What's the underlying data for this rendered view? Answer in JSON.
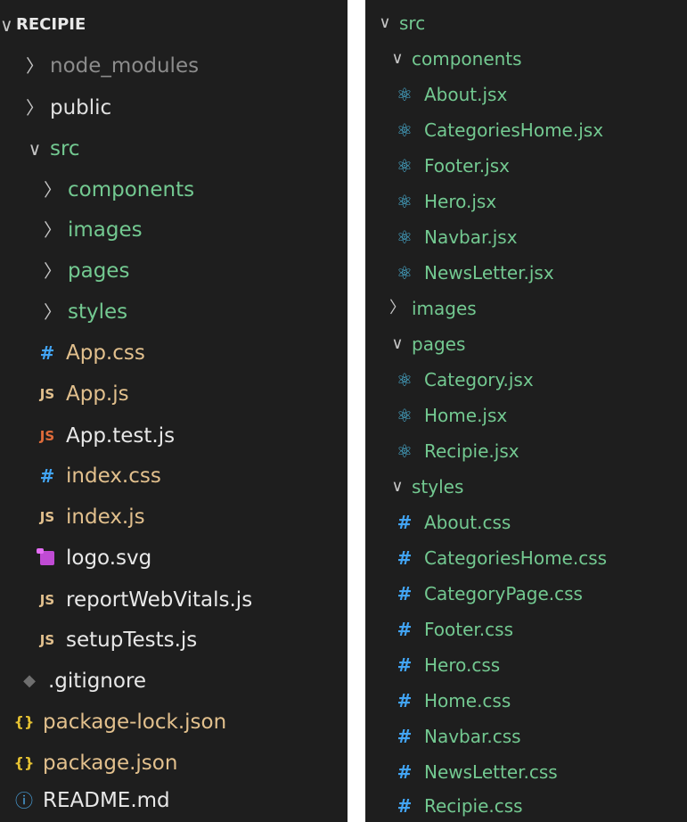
{
  "colors": {
    "background": "#1e1e1e",
    "git_untracked": "#73c991",
    "git_modified": "#e2c08d",
    "react_icon": "#4ec0e8",
    "css_icon": "#42a5f5",
    "json_icon": "#e6c232"
  },
  "icons": {
    "chevron_expanded": "∨",
    "chevron_collapsed": "〉",
    "css": "#",
    "js": "JS",
    "json": "{}",
    "react": "⚛",
    "info": "ⓘ",
    "git": "◆"
  },
  "left_panel": {
    "root": "RECIPIE",
    "items": [
      {
        "label": "node_modules"
      },
      {
        "label": "public"
      },
      {
        "label": "src"
      },
      {
        "label": "components"
      },
      {
        "label": "images"
      },
      {
        "label": "pages"
      },
      {
        "label": "styles"
      },
      {
        "label": "App.css"
      },
      {
        "label": "App.js"
      },
      {
        "label": "App.test.js"
      },
      {
        "label": "index.css"
      },
      {
        "label": "index.js"
      },
      {
        "label": "logo.svg"
      },
      {
        "label": "reportWebVitals.js"
      },
      {
        "label": "setupTests.js"
      },
      {
        "label": ".gitignore"
      },
      {
        "label": "package-lock.json"
      },
      {
        "label": "package.json"
      },
      {
        "label": "README.md"
      }
    ]
  },
  "right_panel": {
    "items": [
      {
        "label": "src"
      },
      {
        "label": "components"
      },
      {
        "label": "About.jsx"
      },
      {
        "label": "CategoriesHome.jsx"
      },
      {
        "label": "Footer.jsx"
      },
      {
        "label": "Hero.jsx"
      },
      {
        "label": "Navbar.jsx"
      },
      {
        "label": "NewsLetter.jsx"
      },
      {
        "label": "images"
      },
      {
        "label": "pages"
      },
      {
        "label": "Category.jsx"
      },
      {
        "label": "Home.jsx"
      },
      {
        "label": "Recipie.jsx"
      },
      {
        "label": "styles"
      },
      {
        "label": "About.css"
      },
      {
        "label": "CategoriesHome.css"
      },
      {
        "label": "CategoryPage.css"
      },
      {
        "label": "Footer.css"
      },
      {
        "label": "Hero.css"
      },
      {
        "label": "Home.css"
      },
      {
        "label": "Navbar.css"
      },
      {
        "label": "NewsLetter.css"
      },
      {
        "label": "Recipie.css"
      }
    ]
  }
}
